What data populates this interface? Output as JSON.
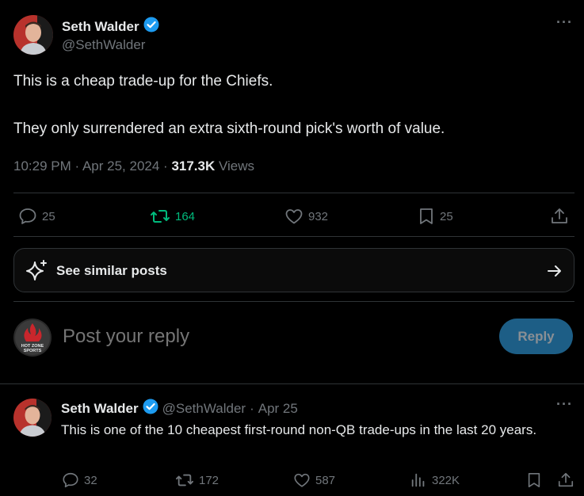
{
  "main_tweet": {
    "author_name": "Seth Walder",
    "handle": "@SethWalder",
    "more_icon": "more-horizontal-icon",
    "text_line1": "This is a cheap trade-up for the Chiefs.",
    "text_line2": "They only surrendered an extra sixth-round pick's worth of value.",
    "time": "10:29 PM",
    "date": "Apr 25, 2024",
    "views_count": "317.3K",
    "views_label": "Views",
    "replies": "25",
    "reposts": "164",
    "likes": "932",
    "bookmarks": "25"
  },
  "similar_posts": {
    "label": "See similar posts",
    "icon": "sparkle-icon",
    "arrow": "arrow-right-icon"
  },
  "reply_box": {
    "placeholder": "Post your reply",
    "button": "Reply",
    "avatar_text_line1": "HOT ZONE",
    "avatar_text_line2": "SPORTS"
  },
  "reply_tweet": {
    "author_name": "Seth Walder",
    "handle": "@SethWalder",
    "separator": "·",
    "date": "Apr 25",
    "text": "This is one of the 10 cheapest first-round non-QB trade-ups in the last 20 years.",
    "replies": "32",
    "reposts": "172",
    "likes": "587",
    "views": "322K"
  },
  "colors": {
    "background": "#000000",
    "text": "#e7e9ea",
    "muted": "#71767b",
    "verified": "#1d9bf0",
    "repost_active": "#00ba7c",
    "reply_button": "#1d5e86"
  }
}
